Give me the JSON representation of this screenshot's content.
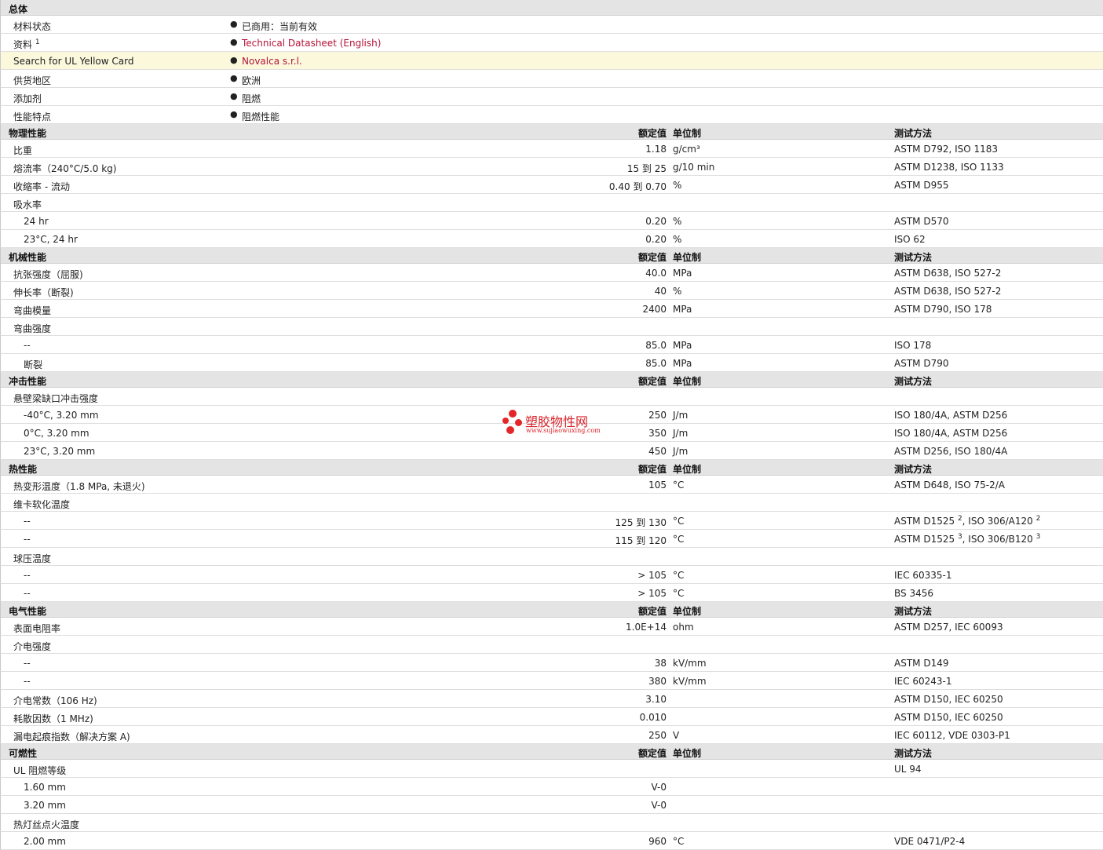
{
  "headers": {
    "value": "额定值",
    "unit": "单位制",
    "method": "测试方法"
  },
  "general": {
    "title": "总体",
    "rows": [
      {
        "label": "材料状态",
        "value": "已商用：当前有效"
      },
      {
        "label": "资料",
        "sup": "1",
        "value": "Technical Datasheet (English)",
        "link": true
      },
      {
        "label": "Search for UL Yellow Card",
        "value": "Novalca s.r.l.",
        "link": true,
        "highlight": true
      },
      {
        "label": "供货地区",
        "value": "欧洲"
      },
      {
        "label": "添加剂",
        "value": "阻燃"
      },
      {
        "label": "性能特点",
        "value": "阻燃性能"
      }
    ]
  },
  "sections": [
    {
      "title": "物理性能",
      "rows": [
        {
          "label": "比重",
          "value": "1.18",
          "unit": "g/cm³",
          "method": "ASTM D792, ISO 1183"
        },
        {
          "label": "熔流率（240°C/5.0 kg)",
          "value": "15 到  25",
          "unit": "g/10 min",
          "method": "ASTM D1238, ISO 1133"
        },
        {
          "label": "收缩率  - 流动",
          "value": "0.40 到  0.70",
          "unit": "%",
          "method": "ASTM D955"
        },
        {
          "label": "吸水率"
        },
        {
          "label": "24 hr",
          "sub": true,
          "value": "0.20",
          "unit": "%",
          "method": "ASTM D570"
        },
        {
          "label": "23°C, 24 hr",
          "sub": true,
          "value": "0.20",
          "unit": "%",
          "method": "ISO 62"
        }
      ]
    },
    {
      "title": "机械性能",
      "rows": [
        {
          "label": "抗张强度（屈服)",
          "value": "40.0",
          "unit": "MPa",
          "method": "ASTM D638, ISO 527-2"
        },
        {
          "label": "伸长率（断裂)",
          "value": "40",
          "unit": "%",
          "method": "ASTM D638, ISO 527-2"
        },
        {
          "label": "弯曲模量",
          "value": "2400",
          "unit": "MPa",
          "method": "ASTM D790, ISO 178"
        },
        {
          "label": "弯曲强度"
        },
        {
          "label": "--",
          "sub": true,
          "value": "85.0",
          "unit": "MPa",
          "method": "ISO 178"
        },
        {
          "label": "断裂",
          "sub": true,
          "value": "85.0",
          "unit": "MPa",
          "method": "ASTM D790"
        }
      ]
    },
    {
      "title": "冲击性能",
      "rows": [
        {
          "label": "悬壁梁缺口冲击强度"
        },
        {
          "label": "-40°C, 3.20 mm",
          "sub": true,
          "value": "250",
          "unit": "J/m",
          "method": "ISO 180/4A, ASTM D256"
        },
        {
          "label": "0°C, 3.20 mm",
          "sub": true,
          "value": "350",
          "unit": "J/m",
          "method": "ISO 180/4A, ASTM D256"
        },
        {
          "label": "23°C, 3.20 mm",
          "sub": true,
          "value": "450",
          "unit": "J/m",
          "method": "ASTM D256, ISO 180/4A"
        }
      ]
    },
    {
      "title": "热性能",
      "rows": [
        {
          "label": "热变形温度（1.8 MPa, 未退火)",
          "value": "105",
          "unit": "°C",
          "method": "ASTM D648, ISO 75-2/A"
        },
        {
          "label": "维卡软化温度"
        },
        {
          "label": "--",
          "sub": true,
          "value": "125 到  130",
          "unit": "°C",
          "method": "ASTM D1525",
          "method_sup": "2",
          "method2": ", ISO 306/A120",
          "method2_sup": "2"
        },
        {
          "label": "--",
          "sub": true,
          "value": "115 到  120",
          "unit": "°C",
          "method": "ASTM D1525",
          "method_sup": "3",
          "method2": ", ISO 306/B120",
          "method2_sup": "3"
        },
        {
          "label": "球压温度"
        },
        {
          "label": "--",
          "sub": true,
          "value": "> 105",
          "unit": "°C",
          "method": "IEC 60335-1"
        },
        {
          "label": "--",
          "sub": true,
          "value": "> 105",
          "unit": "°C",
          "method": "BS 3456"
        }
      ]
    },
    {
      "title": "电气性能",
      "rows": [
        {
          "label": "表面电阻率",
          "value": "1.0E+14",
          "unit": "ohm",
          "method": "ASTM D257, IEC 60093"
        },
        {
          "label": "介电强度"
        },
        {
          "label": "--",
          "sub": true,
          "value": "38",
          "unit": "kV/mm",
          "method": "ASTM D149"
        },
        {
          "label": "--",
          "sub": true,
          "value": "380",
          "unit": "kV/mm",
          "method": "IEC 60243-1"
        },
        {
          "label": "介电常数（106 Hz)",
          "value": "3.10",
          "method": "ASTM D150, IEC 60250"
        },
        {
          "label": "耗散因数（1 MHz)",
          "value": "0.010",
          "method": "ASTM D150, IEC 60250"
        },
        {
          "label": "漏电起痕指数（解决方案  A)",
          "value": "250",
          "unit": "V",
          "method": "IEC 60112, VDE 0303-P1"
        }
      ]
    },
    {
      "title": "可燃性",
      "rows": [
        {
          "label": "UL 阻燃等级",
          "method": "UL 94"
        },
        {
          "label": "1.60 mm",
          "sub": true,
          "value": "V-0"
        },
        {
          "label": "3.20 mm",
          "sub": true,
          "value": "V-0"
        },
        {
          "label": "热灯丝点火温度"
        },
        {
          "label": "2.00 mm",
          "sub": true,
          "value": "960",
          "unit": "°C",
          "method": "VDE 0471/P2-4"
        }
      ]
    }
  ],
  "watermark": {
    "name": "塑胶物性网",
    "url": "www.sujiaowuxing.com",
    "color": "#d9232b"
  }
}
